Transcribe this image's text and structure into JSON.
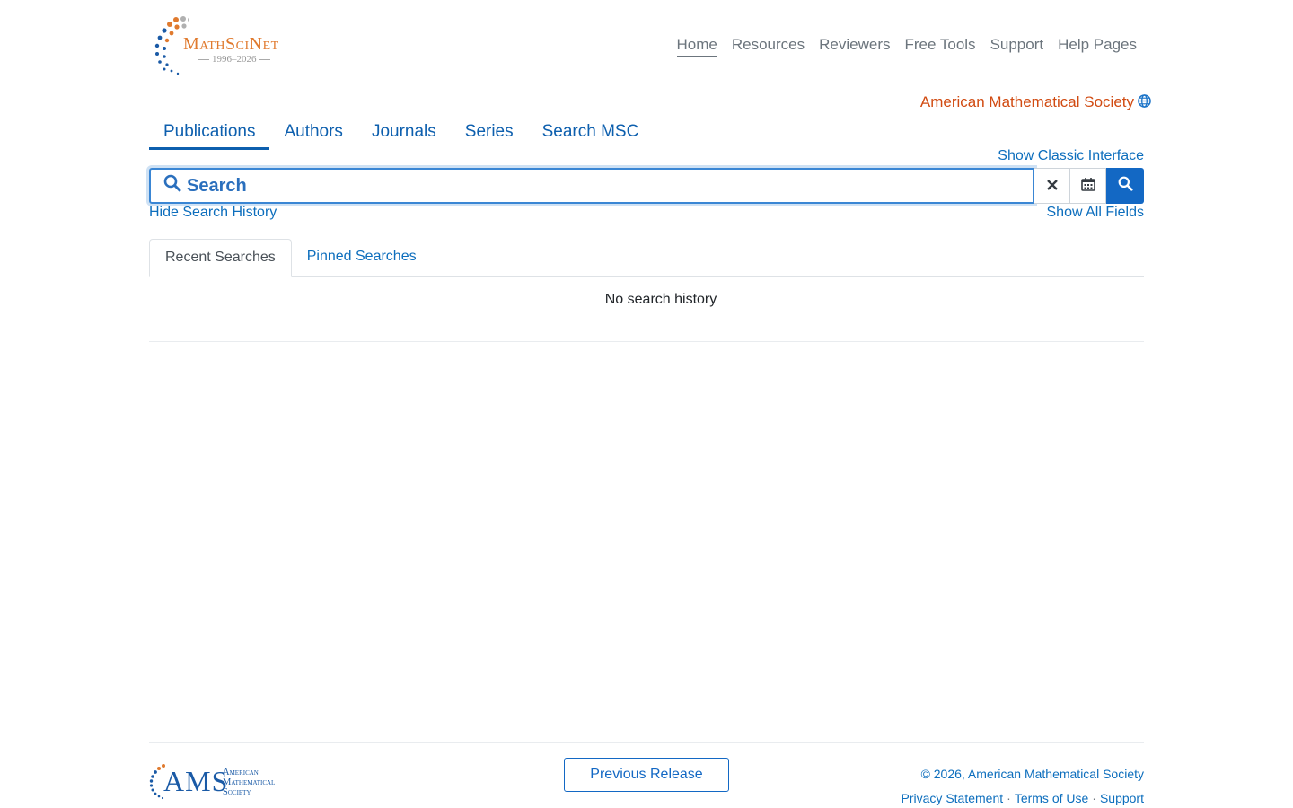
{
  "logo": {
    "brand": "MathSciNet",
    "years": "1996–2026"
  },
  "topnav": [
    {
      "label": "Home",
      "active": true
    },
    {
      "label": "Resources"
    },
    {
      "label": "Reviewers"
    },
    {
      "label": "Free Tools"
    },
    {
      "label": "Support"
    },
    {
      "label": "Help Pages"
    }
  ],
  "ams_link": {
    "label": "American Mathematical Society",
    "icon": "globe-icon"
  },
  "main_tabs": [
    {
      "label": "Publications",
      "active": true
    },
    {
      "label": "Authors"
    },
    {
      "label": "Journals"
    },
    {
      "label": "Series"
    },
    {
      "label": "Search MSC"
    }
  ],
  "classic_link": "Show Classic Interface",
  "search": {
    "placeholder": "Search",
    "value": "",
    "clear_icon": "close-icon",
    "calendar_icon": "calendar-icon",
    "submit_icon": "search-icon"
  },
  "hide_history": "Hide Search History",
  "show_all_fields": "Show All Fields",
  "history_tabs": [
    {
      "label": "Recent Searches",
      "active": true
    },
    {
      "label": "Pinned Searches"
    }
  ],
  "no_history": "No search history",
  "footer": {
    "ams_letters": "AMS",
    "ams_words": [
      "American",
      "Mathematical",
      "Society"
    ],
    "previous_release": "Previous Release",
    "copyright": "© 2026, American Mathematical Society",
    "links": [
      "Privacy Statement",
      "Terms of Use",
      "Support"
    ]
  },
  "colors": {
    "link": "#0d6ebd",
    "accent_orange": "#d14b12",
    "primary": "#1368c4"
  }
}
